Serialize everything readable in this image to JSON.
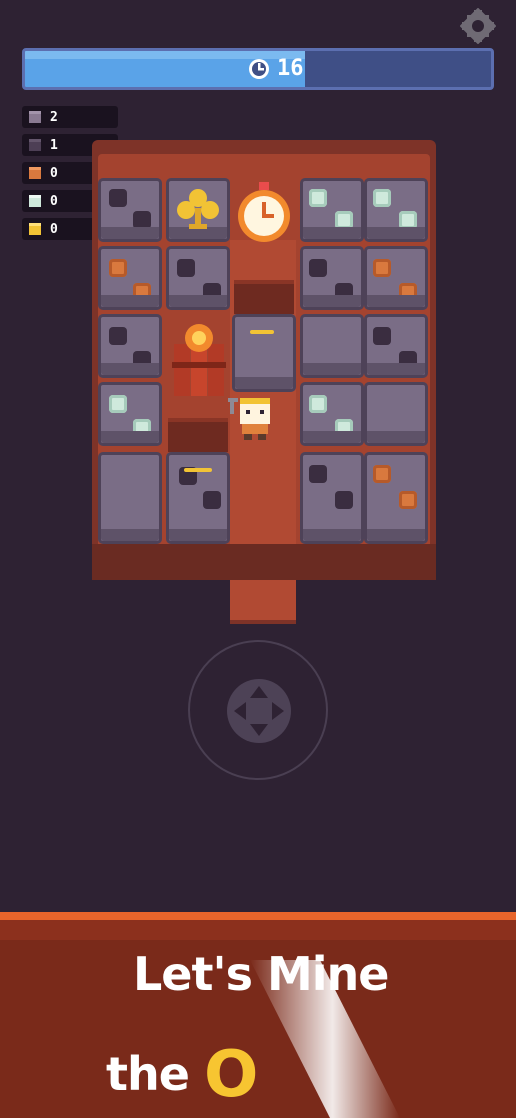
{
  "hud": {
    "timer_value": "16",
    "timer_fraction": 0.6,
    "icons": {
      "settings": "gear-icon",
      "timer": "clock-icon"
    }
  },
  "resources": [
    {
      "name": "stone",
      "count": "2",
      "color": "#8a7a92"
    },
    {
      "name": "coal",
      "count": "1",
      "color": "#4d3f55"
    },
    {
      "name": "copper",
      "count": "0",
      "color": "#d9793e"
    },
    {
      "name": "silver",
      "count": "0",
      "color": "#cfe9dc"
    },
    {
      "name": "gold",
      "count": "0",
      "color": "#f2c335"
    }
  ],
  "board": {
    "items": [
      "clover-icon",
      "stopwatch-icon",
      "dynamite-icon",
      "miner-character"
    ],
    "ores": [
      "coal",
      "copper",
      "silver"
    ]
  },
  "banner": {
    "line1": "Let's Mine",
    "line2_prefix": "the",
    "line2_accent": "O"
  },
  "colors": {
    "background": "#2e2233",
    "board": "#a4432f",
    "timer_fill": "#5aa3e8",
    "banner": "#7a2a1a",
    "accent": "#f7c531"
  }
}
